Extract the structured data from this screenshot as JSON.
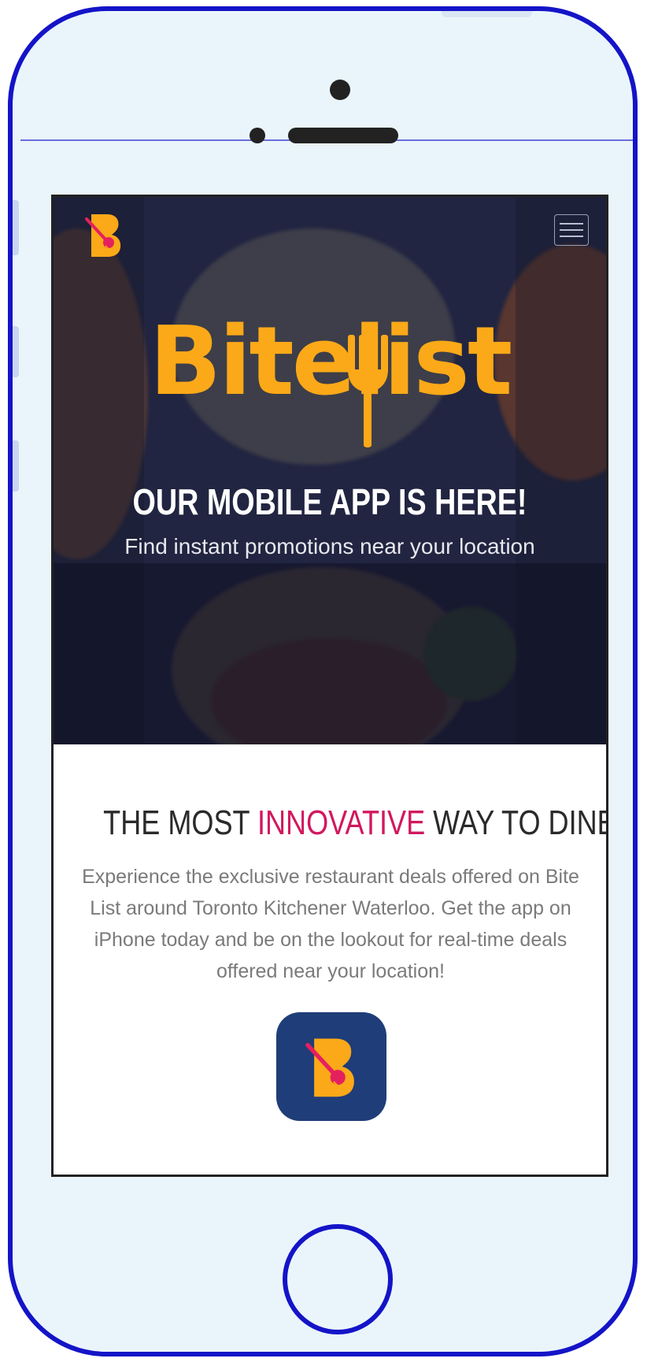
{
  "app": {
    "brand_name": "Bitelist",
    "menu_label": "menu",
    "logo_icon": "bitelist-logo-icon",
    "brand_color": "#fba918",
    "accent_color": "#d2175e",
    "device_color": "#1414c8"
  },
  "hero": {
    "title": "OUR MOBILE APP IS HERE!",
    "subtitle": "Find instant promotions near your location"
  },
  "section": {
    "headline_prefix": "THE MOST ",
    "headline_highlight": "INNOVATIVE",
    "headline_suffix": " WAY TO DINE",
    "description": "Experience the exclusive restaurant deals offered on Bite List around Toronto Kitchener Waterloo. Get the app on iPhone today and be on the lookout for real-time deals offered near your location!",
    "app_icon": "bitelist-app-icon"
  }
}
